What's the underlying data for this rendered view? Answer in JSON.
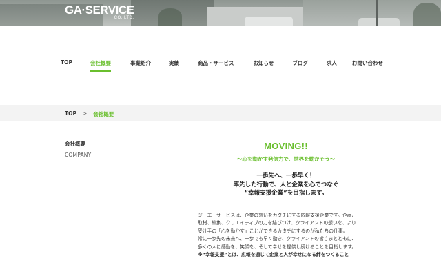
{
  "header": {
    "logo_main": "GA·SERVICE",
    "logo_sub": "CO.,LTD."
  },
  "nav": {
    "items": [
      {
        "label": "TOP",
        "active": false
      },
      {
        "label": "会社概要",
        "active": true
      },
      {
        "label": "事業紹介",
        "active": false
      },
      {
        "label": "実績",
        "active": false
      },
      {
        "label": "商品・サービス",
        "active": false
      },
      {
        "label": "お知らせ",
        "active": false
      },
      {
        "label": "ブログ",
        "active": false
      },
      {
        "label": "求人",
        "active": false
      },
      {
        "label": "お問い合わせ",
        "active": false
      }
    ]
  },
  "breadcrumb": {
    "home": "TOP",
    "separator": ">",
    "current": "会社概要"
  },
  "side": {
    "title_ja": "会社概要",
    "title_en": "COMPANY"
  },
  "main": {
    "headline": "MOVING!!",
    "subheadline": "〜心を動かす発信力で、世界を動かそう〜",
    "catch_lines": [
      "一歩先へ、一歩早く！",
      "率先した行動で、人と企業を心でつなぐ",
      "“幸報支援企業”を目指します。"
    ],
    "body_lines": [
      "ジーエーサービスは、企業の想いをカタチにする広報支援企業です。企画、",
      "取材、編集、クリエイティブの力を結びつけ、クライアントの想いを、より",
      "受け手の「心を動かす」ことができるカタチにするのが私たちの仕事。",
      "常に一歩先の未来へ、一歩でも早く動き、クライアントの皆さまとともに、",
      "多くの人に感動を、笑顔を、そして幸せを提供し続けることを目指します。"
    ],
    "note": "※“幸報支援”とは、広報を通じて企業と人が幸せになる絆をつくること"
  },
  "colors": {
    "accent": "#6abf2e",
    "breadcrumb_bg": "#f3f3f3",
    "text": "#333333"
  }
}
